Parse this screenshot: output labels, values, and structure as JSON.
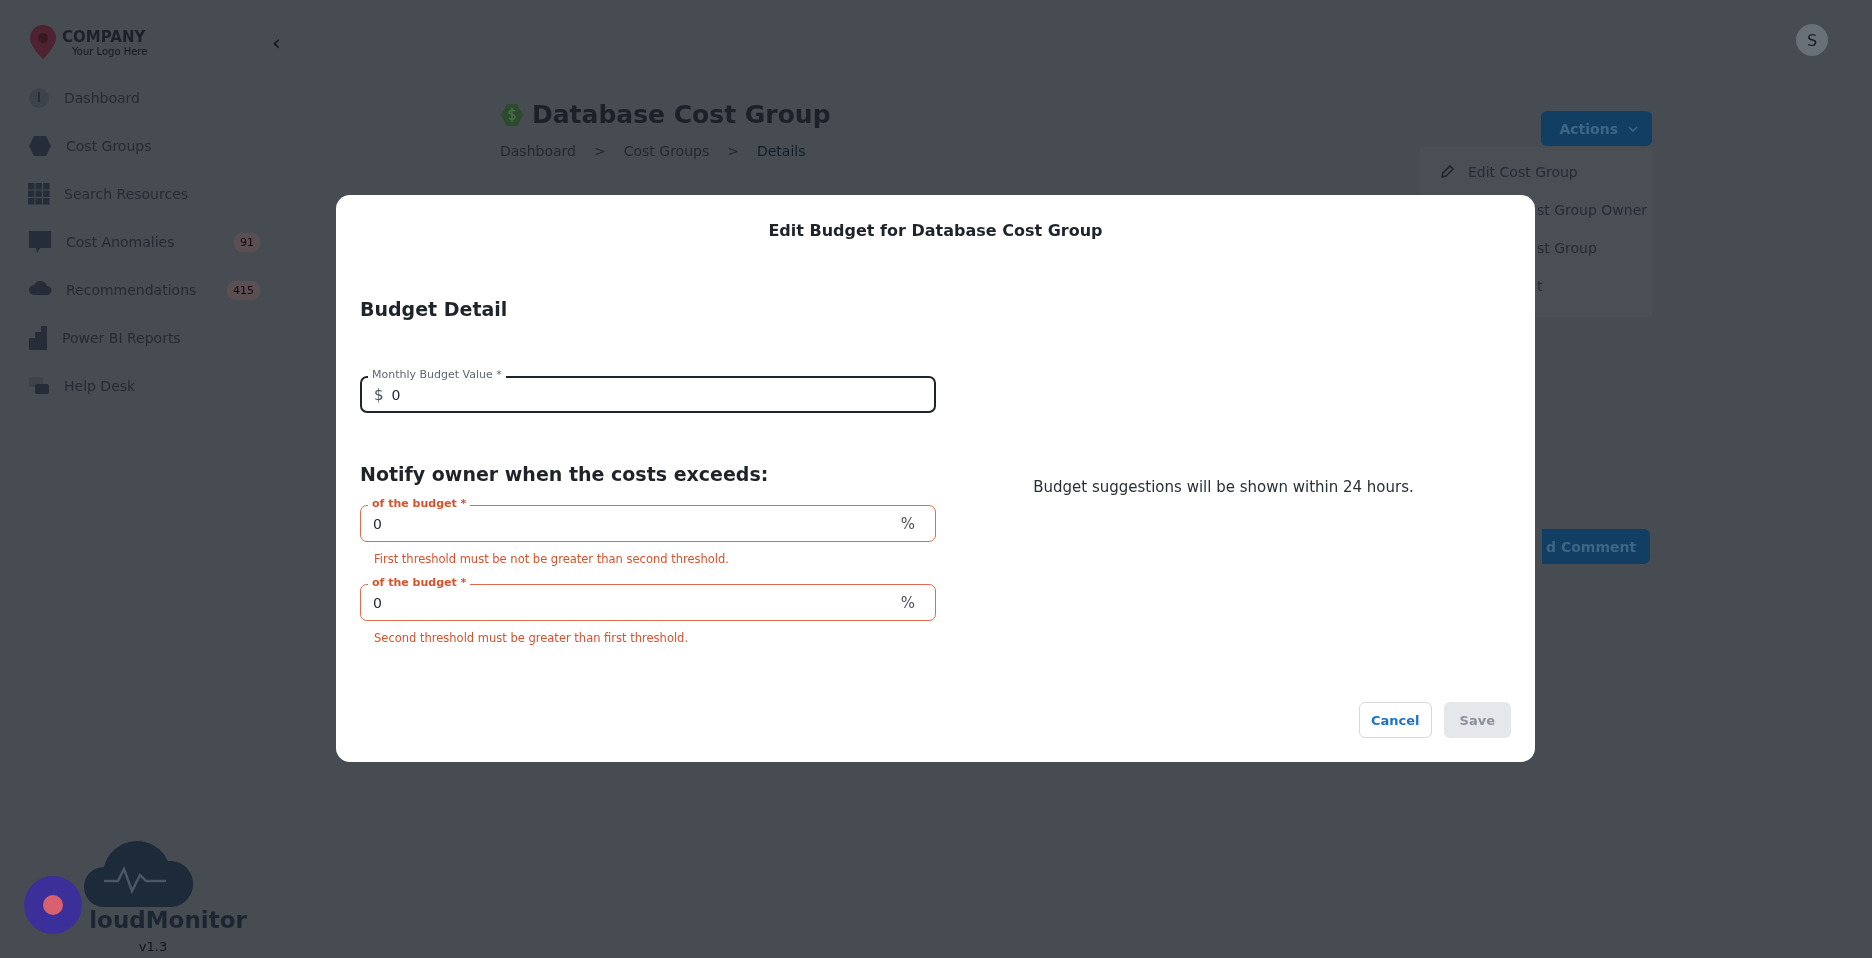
{
  "sidebar": {
    "logo": {
      "name": "COMPANY",
      "tagline": "Your Logo Here"
    },
    "collapse": "‹",
    "items": [
      {
        "label": "Dashboard"
      },
      {
        "label": "Cost Groups"
      },
      {
        "label": "Search Resources"
      },
      {
        "label": "Cost Anomalies",
        "badge": "91"
      },
      {
        "label": "Recommendations",
        "badge": "415"
      },
      {
        "label": "Power BI Reports"
      },
      {
        "label": "Help Desk"
      }
    ],
    "product": {
      "name": "loudMonitor",
      "version": "v1.3"
    }
  },
  "avatar": {
    "initial": "S"
  },
  "header": {
    "title": "Database Cost Group",
    "breadcrumb": [
      {
        "label": "Dashboard",
        "current": false
      },
      {
        "label": "Cost Groups",
        "current": false
      },
      {
        "label": "Details",
        "current": true
      }
    ],
    "separator": ">",
    "actions": "Actions"
  },
  "actions_menu": [
    "Edit Cost Group",
    "st Group Owner",
    "st Group",
    "t"
  ],
  "comment_button": "d Comment",
  "modal": {
    "title": "Edit Budget for Database Cost Group",
    "section": "Budget Detail",
    "budget_field": {
      "label": "Monthly Budget Value *",
      "prefix": "$",
      "value": "0",
      "focused": true
    },
    "notify_heading": "Notify owner when the costs exceeds:",
    "thresholds": [
      {
        "label": "of the budget *",
        "value": "0",
        "suffix": "%",
        "invalid": true,
        "error": "First threshold must be not be greater than second threshold."
      },
      {
        "label": "of the budget *",
        "value": "0",
        "suffix": "%",
        "invalid": true,
        "error": "Second threshold must be greater than first threshold."
      }
    ],
    "suggestion": "Budget suggestions will be shown within 24 hours.",
    "cancel": "Cancel",
    "save": {
      "label": "Save",
      "disabled": true
    }
  }
}
